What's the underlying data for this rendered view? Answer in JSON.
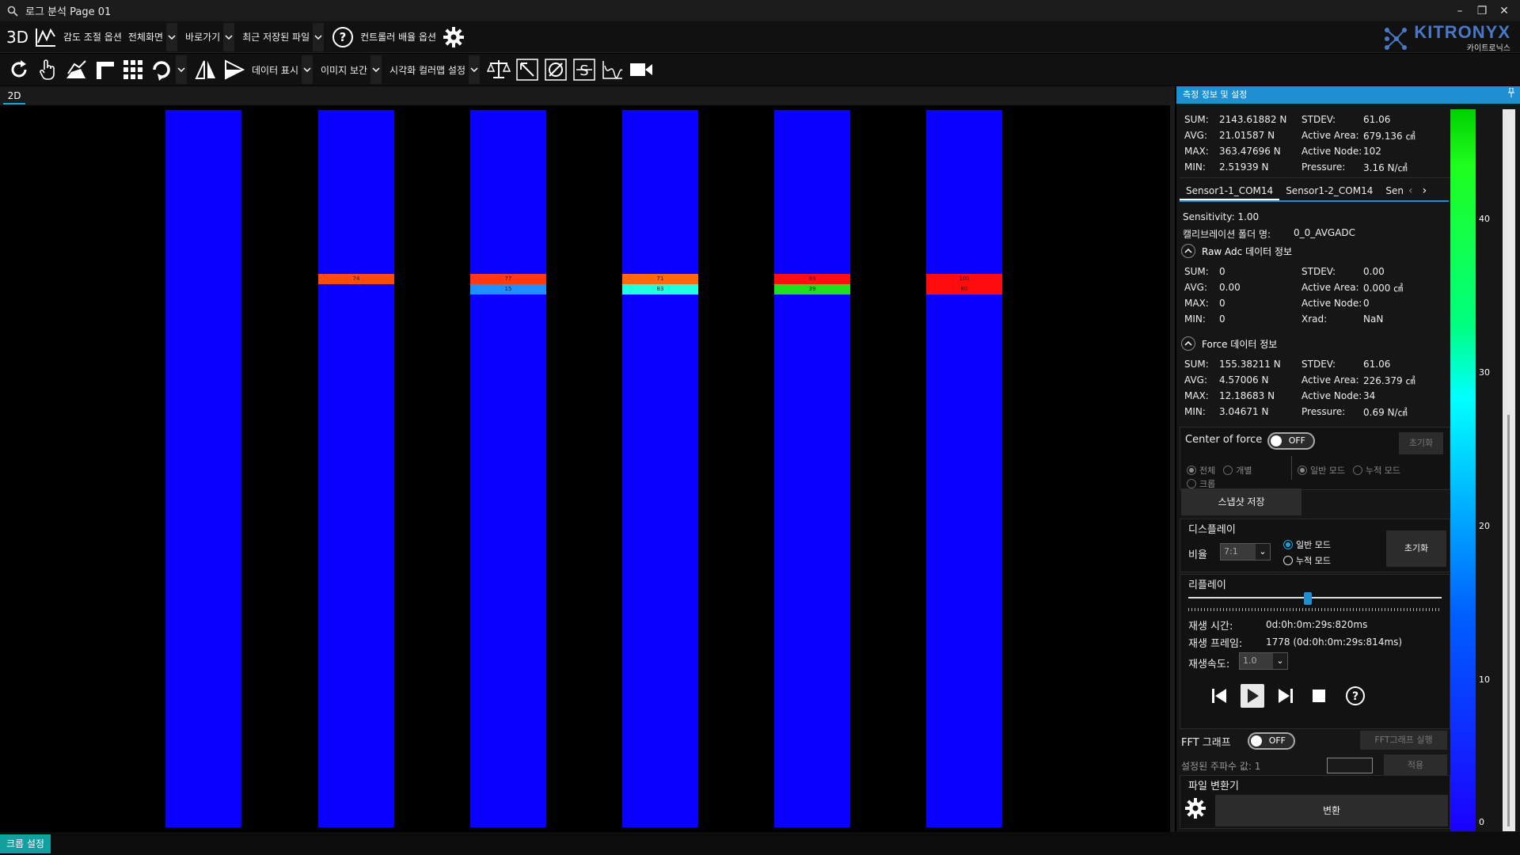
{
  "window": {
    "title": "로그 분석 Page 01"
  },
  "toolbar1": {
    "label_3d": "3D",
    "sensitivity": "감도 조절 옵션",
    "fullscreen": "전체화면",
    "shortcut": "바로가기",
    "recent_file": "최근 저장된 파일",
    "controller_layout": "컨트롤러 배율 옵션"
  },
  "toolbar2": {
    "data_display": "데이터 표시",
    "image_interp": "이미지 보간",
    "color_map": "시각화 컬러맵 설정"
  },
  "brand": {
    "name": "KITRONYX",
    "sub": "카이트로닉스"
  },
  "view": {
    "tab": "2D"
  },
  "bars": [
    {
      "cells": []
    },
    {
      "cells": [
        {
          "label": "74",
          "color": "#ff4a10",
          "row": 0
        }
      ]
    },
    {
      "cells": [
        {
          "label": "77",
          "color": "#ff3a10",
          "row": 0
        },
        {
          "label": "15",
          "color": "#1f8fff",
          "row": 1
        }
      ]
    },
    {
      "cells": [
        {
          "label": "71",
          "color": "#ff6a08",
          "row": 0
        },
        {
          "label": "83",
          "color": "#20ffe0",
          "row": 1
        }
      ]
    },
    {
      "cells": [
        {
          "label": "93",
          "color": "#ff1010",
          "row": 0
        },
        {
          "label": "39",
          "color": "#20e020",
          "row": 1
        }
      ]
    },
    {
      "cells": [
        {
          "label": "100",
          "color": "#ff0c0c",
          "row": 0
        },
        {
          "label": "80",
          "color": "#ff0c0c",
          "row": 1
        }
      ]
    }
  ],
  "statusbar": {
    "crop_button": "크롭 설정"
  },
  "panel": {
    "title": "측정 정보 및 설정",
    "summary": {
      "sum_k": "SUM:",
      "sum_v": "2143.61882 N",
      "stdev_k": "STDEV:",
      "stdev_v": "61.06",
      "avg_k": "AVG:",
      "avg_v": "21.01587 N",
      "area_k": "Active Area:",
      "area_v": "679.136 ㎠",
      "max_k": "MAX:",
      "max_v": "363.47696 N",
      "node_k": "Active Node:",
      "node_v": "102",
      "min_k": "MIN:",
      "min_v": "2.51939 N",
      "press_k": "Pressure:",
      "press_v": "3.16 N/㎠"
    },
    "sensor_tabs": [
      "Sensor1-1_COM14",
      "Sensor1-2_COM14",
      "Sen"
    ],
    "sensitivity": "Sensitivity:  1.00",
    "calib_folder": "캘리브레이션 폴더 명:",
    "calib_value": "0_0_AVGADC",
    "raw": {
      "title": "Raw Adc 데이터 정보",
      "sum_k": "SUM:",
      "sum_v": "0",
      "stdev_k": "STDEV:",
      "stdev_v": "0.00",
      "avg_k": "AVG:",
      "avg_v": "0.00",
      "area_k": "Active Area:",
      "area_v": "0.000 ㎠",
      "max_k": "MAX:",
      "max_v": "0",
      "node_k": "Active Node:",
      "node_v": "0",
      "min_k": "MIN:",
      "min_v": "0",
      "xrad_k": "Xrad:",
      "xrad_v": "NaN"
    },
    "force": {
      "title": "Force 데이터 정보",
      "sum_k": "SUM:",
      "sum_v": "155.38211 N",
      "stdev_k": "STDEV:",
      "stdev_v": "61.06",
      "avg_k": "AVG:",
      "avg_v": "4.57006 N",
      "area_k": "Active Area:",
      "area_v": "226.379 ㎠",
      "max_k": "MAX:",
      "max_v": "12.18683 N",
      "node_k": "Active Node:",
      "node_v": "34",
      "min_k": "MIN:",
      "min_v": "3.04671 N",
      "press_k": "Pressure:",
      "press_v": "0.69 N/㎠"
    },
    "cof": {
      "label": "Center of force",
      "toggle": "OFF",
      "reset": "초기화",
      "opt_all": "전체",
      "opt_each": "개별",
      "opt_crop": "크롭",
      "mode_normal": "일반 모드",
      "mode_accum": "누적 모드"
    },
    "snapshot": "스냅샷 저장",
    "display": {
      "title": "디스플레이",
      "ratio_label": "비율",
      "ratio_value": "7:1",
      "mode_normal": "일반 모드",
      "mode_accum": "누적 모드",
      "reset": "초기화"
    },
    "replay": {
      "title": "리플레이",
      "slider_fraction": 0.47,
      "time_label": "재생 시간:",
      "time_value": "0d:0h:0m:29s:820ms",
      "frame_label": "재생 프레임:",
      "frame_value": "1778  (0d:0h:0m:29s:814ms)",
      "speed_label": "재생속도:",
      "speed_value": "1.0"
    },
    "fft": {
      "label": "FFT 그래프",
      "toggle": "OFF",
      "run": "FFT그래프 실행",
      "freq_label": "설정된 주파수 값: 1",
      "apply": "적용"
    },
    "converter": {
      "title": "파일 변환기",
      "convert": "변환"
    }
  },
  "legend": {
    "ticks": [
      "40",
      "30",
      "20",
      "10",
      "0"
    ]
  }
}
